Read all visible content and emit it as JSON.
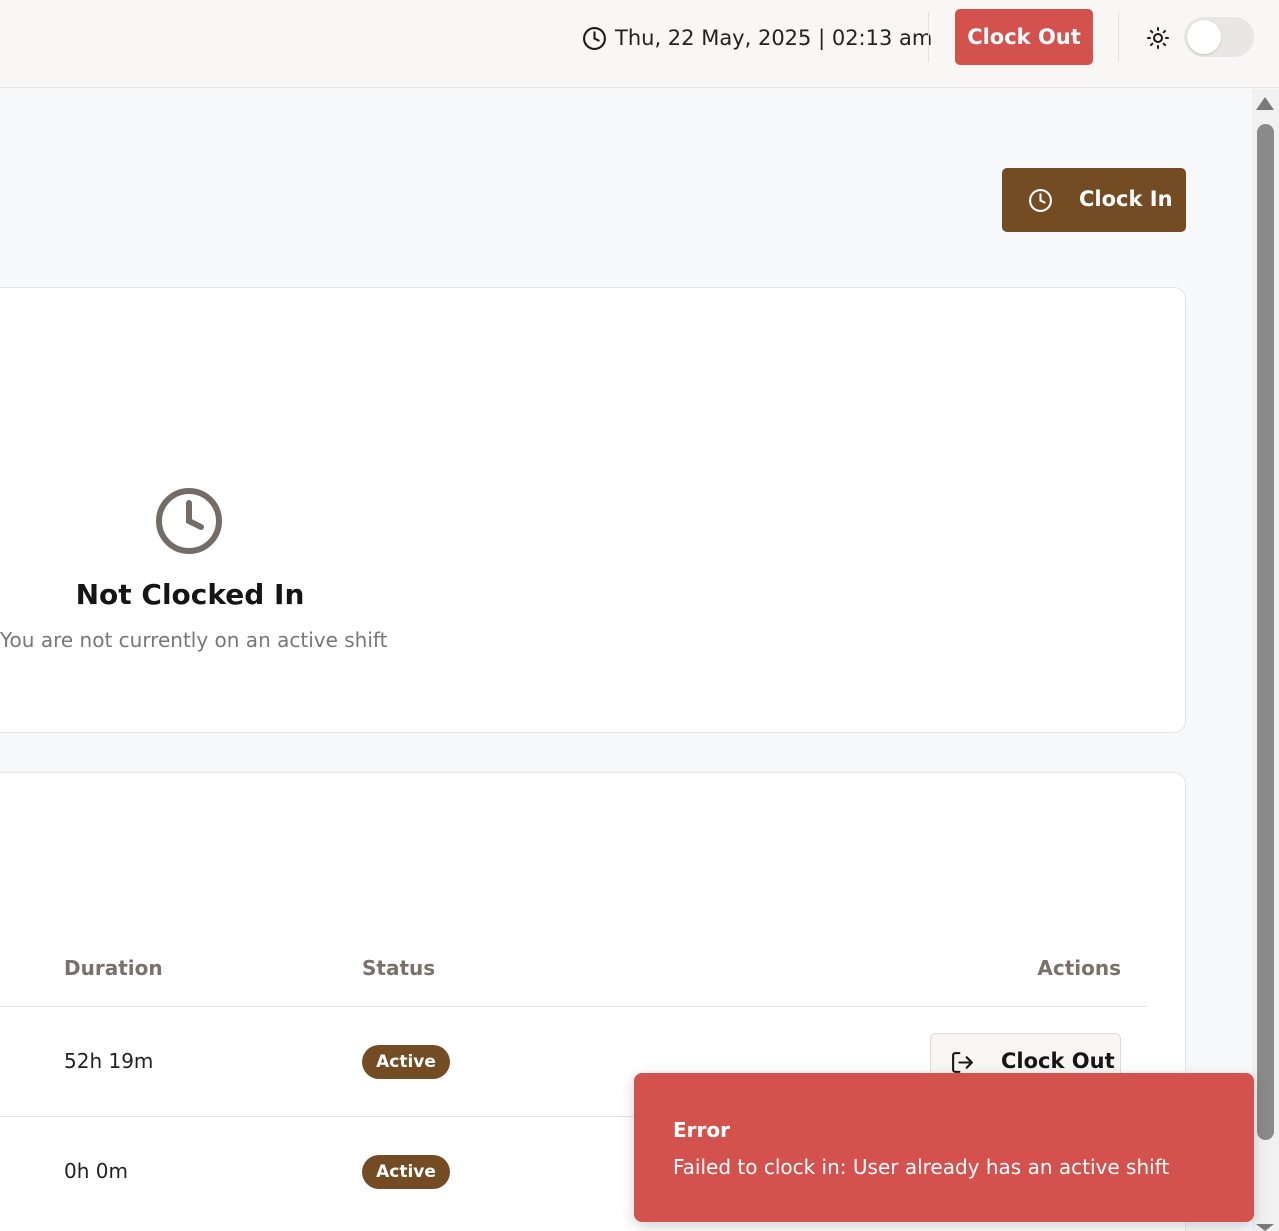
{
  "header": {
    "datetime": "Thu, 22 May, 2025 | 02:13 am",
    "clock_out_label": "Clock Out",
    "theme_toggle_on": false
  },
  "actions": {
    "clock_in_label": "Clock In"
  },
  "status_card": {
    "title": "Not Clocked In",
    "subtitle": "You are not currently on an active shift"
  },
  "shifts_table": {
    "columns": {
      "duration": "Duration",
      "status": "Status",
      "actions": "Actions"
    },
    "rows": [
      {
        "duration": "52h 19m",
        "status": "Active",
        "action_label": "Clock Out"
      },
      {
        "duration": "0h 0m",
        "status": "Active"
      }
    ]
  },
  "toast": {
    "title": "Error",
    "message": "Failed to clock in: User already has an active shift"
  },
  "colors": {
    "brand": "#744c23",
    "danger": "#d4524d"
  }
}
